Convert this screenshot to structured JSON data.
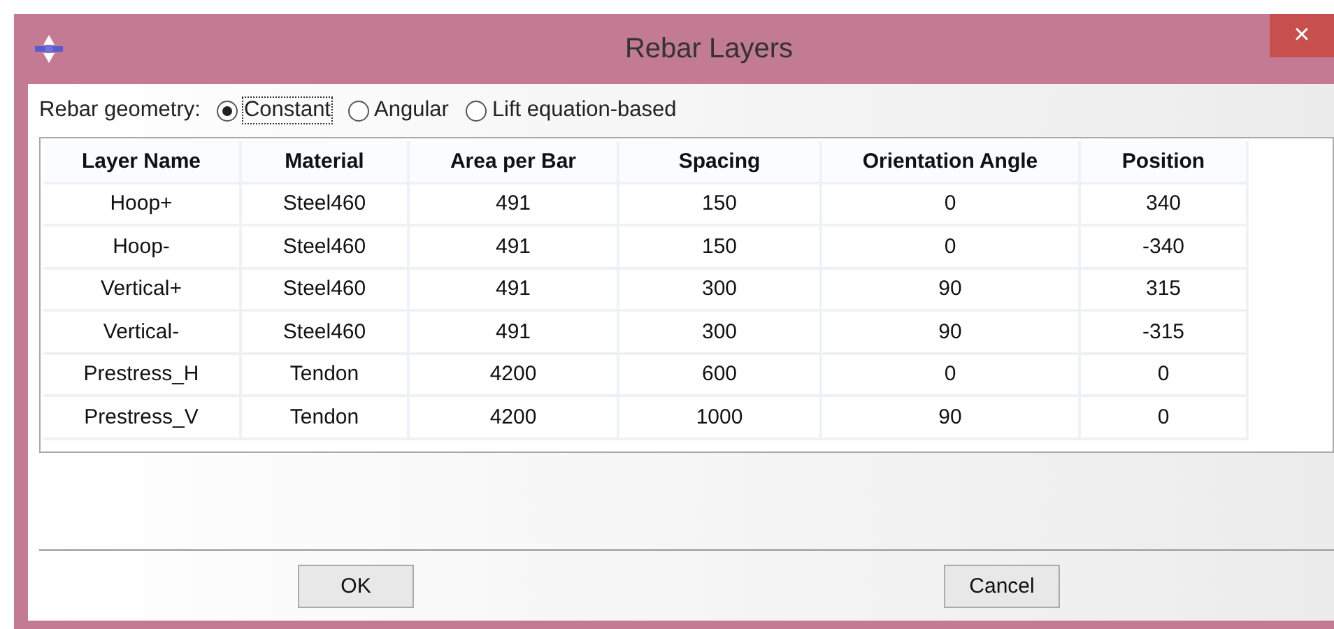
{
  "window": {
    "title": "Rebar Layers",
    "close": "×"
  },
  "geometry": {
    "label": "Rebar geometry:",
    "options": [
      {
        "label": "Constant",
        "selected": true
      },
      {
        "label": "Angular",
        "selected": false
      },
      {
        "label": "Lift equation-based",
        "selected": false
      }
    ]
  },
  "table": {
    "columns": [
      "Layer Name",
      "Material",
      "Area per Bar",
      "Spacing",
      "Orientation Angle",
      "Position"
    ],
    "rows": [
      [
        "Hoop+",
        "Steel460",
        "491",
        "150",
        "0",
        "340"
      ],
      [
        "Hoop-",
        "Steel460",
        "491",
        "150",
        "0",
        "-340"
      ],
      [
        "Vertical+",
        "Steel460",
        "491",
        "300",
        "90",
        "315"
      ],
      [
        "Vertical-",
        "Steel460",
        "491",
        "300",
        "90",
        "-315"
      ],
      [
        "Prestress_H",
        "Tendon",
        "4200",
        "600",
        "0",
        "0"
      ],
      [
        "Prestress_V",
        "Tendon",
        "4200",
        "1000",
        "90",
        "0"
      ]
    ]
  },
  "buttons": [
    "OK",
    "Cancel"
  ]
}
